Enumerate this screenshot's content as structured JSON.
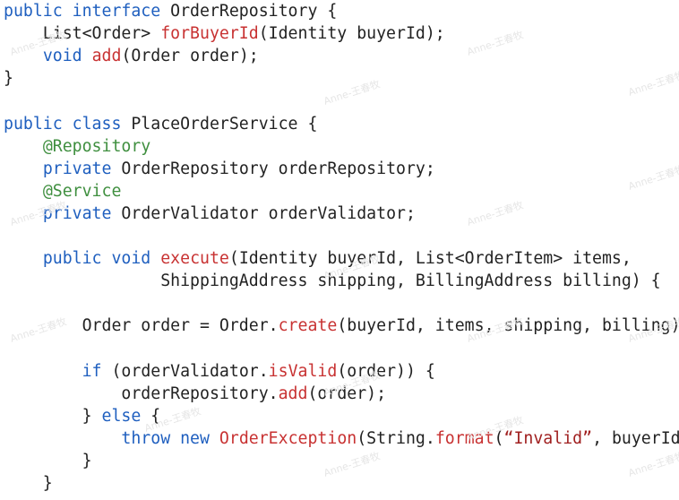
{
  "lines": [
    {
      "segments": [
        {
          "t": "public interface",
          "k": "kw"
        },
        {
          "t": " OrderRepository {",
          "k": "tx"
        }
      ]
    },
    {
      "segments": [
        {
          "t": "    List<Order> ",
          "k": "tx"
        },
        {
          "t": "forBuyerId",
          "k": "fn"
        },
        {
          "t": "(Identity buyerId);",
          "k": "tx"
        }
      ]
    },
    {
      "segments": [
        {
          "t": "    ",
          "k": "tx"
        },
        {
          "t": "void",
          "k": "kw"
        },
        {
          "t": " ",
          "k": "tx"
        },
        {
          "t": "add",
          "k": "fn"
        },
        {
          "t": "(Order order);",
          "k": "tx"
        }
      ]
    },
    {
      "segments": [
        {
          "t": "}",
          "k": "tx"
        }
      ]
    },
    {
      "segments": []
    },
    {
      "segments": [
        {
          "t": "public class",
          "k": "kw"
        },
        {
          "t": " PlaceOrderService {",
          "k": "tx"
        }
      ]
    },
    {
      "segments": [
        {
          "t": "    ",
          "k": "tx"
        },
        {
          "t": "@Repository",
          "k": "an"
        }
      ]
    },
    {
      "segments": [
        {
          "t": "    ",
          "k": "tx"
        },
        {
          "t": "private",
          "k": "kw"
        },
        {
          "t": " OrderRepository orderRepository;",
          "k": "tx"
        }
      ]
    },
    {
      "segments": [
        {
          "t": "    ",
          "k": "tx"
        },
        {
          "t": "@Service",
          "k": "an"
        }
      ]
    },
    {
      "segments": [
        {
          "t": "    ",
          "k": "tx"
        },
        {
          "t": "private",
          "k": "kw"
        },
        {
          "t": " OrderValidator orderValidator;",
          "k": "tx"
        }
      ]
    },
    {
      "segments": []
    },
    {
      "segments": [
        {
          "t": "    ",
          "k": "tx"
        },
        {
          "t": "public void",
          "k": "kw"
        },
        {
          "t": " ",
          "k": "tx"
        },
        {
          "t": "execute",
          "k": "fn"
        },
        {
          "t": "(Identity buyerId, List<OrderItem> items,",
          "k": "tx"
        }
      ]
    },
    {
      "segments": [
        {
          "t": "                ShippingAddress shipping, BillingAddress billing) {",
          "k": "tx"
        }
      ]
    },
    {
      "segments": []
    },
    {
      "segments": [
        {
          "t": "        Order order = Order.",
          "k": "tx"
        },
        {
          "t": "create",
          "k": "fn"
        },
        {
          "t": "(buyerId, items, shipping, billing);",
          "k": "tx"
        }
      ]
    },
    {
      "segments": []
    },
    {
      "segments": [
        {
          "t": "        ",
          "k": "tx"
        },
        {
          "t": "if",
          "k": "kw"
        },
        {
          "t": " (orderValidator.",
          "k": "tx"
        },
        {
          "t": "isValid",
          "k": "fn"
        },
        {
          "t": "(order)) {",
          "k": "tx"
        }
      ]
    },
    {
      "segments": [
        {
          "t": "            orderRepository.",
          "k": "tx"
        },
        {
          "t": "add",
          "k": "fn"
        },
        {
          "t": "(order);",
          "k": "tx"
        }
      ]
    },
    {
      "segments": [
        {
          "t": "        } ",
          "k": "tx"
        },
        {
          "t": "else",
          "k": "kw"
        },
        {
          "t": " {",
          "k": "tx"
        }
      ]
    },
    {
      "segments": [
        {
          "t": "            ",
          "k": "tx"
        },
        {
          "t": "throw new",
          "k": "kw"
        },
        {
          "t": " ",
          "k": "tx"
        },
        {
          "t": "OrderException",
          "k": "fn"
        },
        {
          "t": "(String.",
          "k": "tx"
        },
        {
          "t": "format",
          "k": "fn"
        },
        {
          "t": "(",
          "k": "tx"
        },
        {
          "t": "“Invalid”",
          "k": "str"
        },
        {
          "t": ", buyerId));",
          "k": "tx"
        }
      ]
    },
    {
      "segments": [
        {
          "t": "        }",
          "k": "tx"
        }
      ]
    },
    {
      "segments": [
        {
          "t": "    }",
          "k": "tx"
        }
      ]
    }
  ],
  "watermark_text": "Anne-王春牧"
}
